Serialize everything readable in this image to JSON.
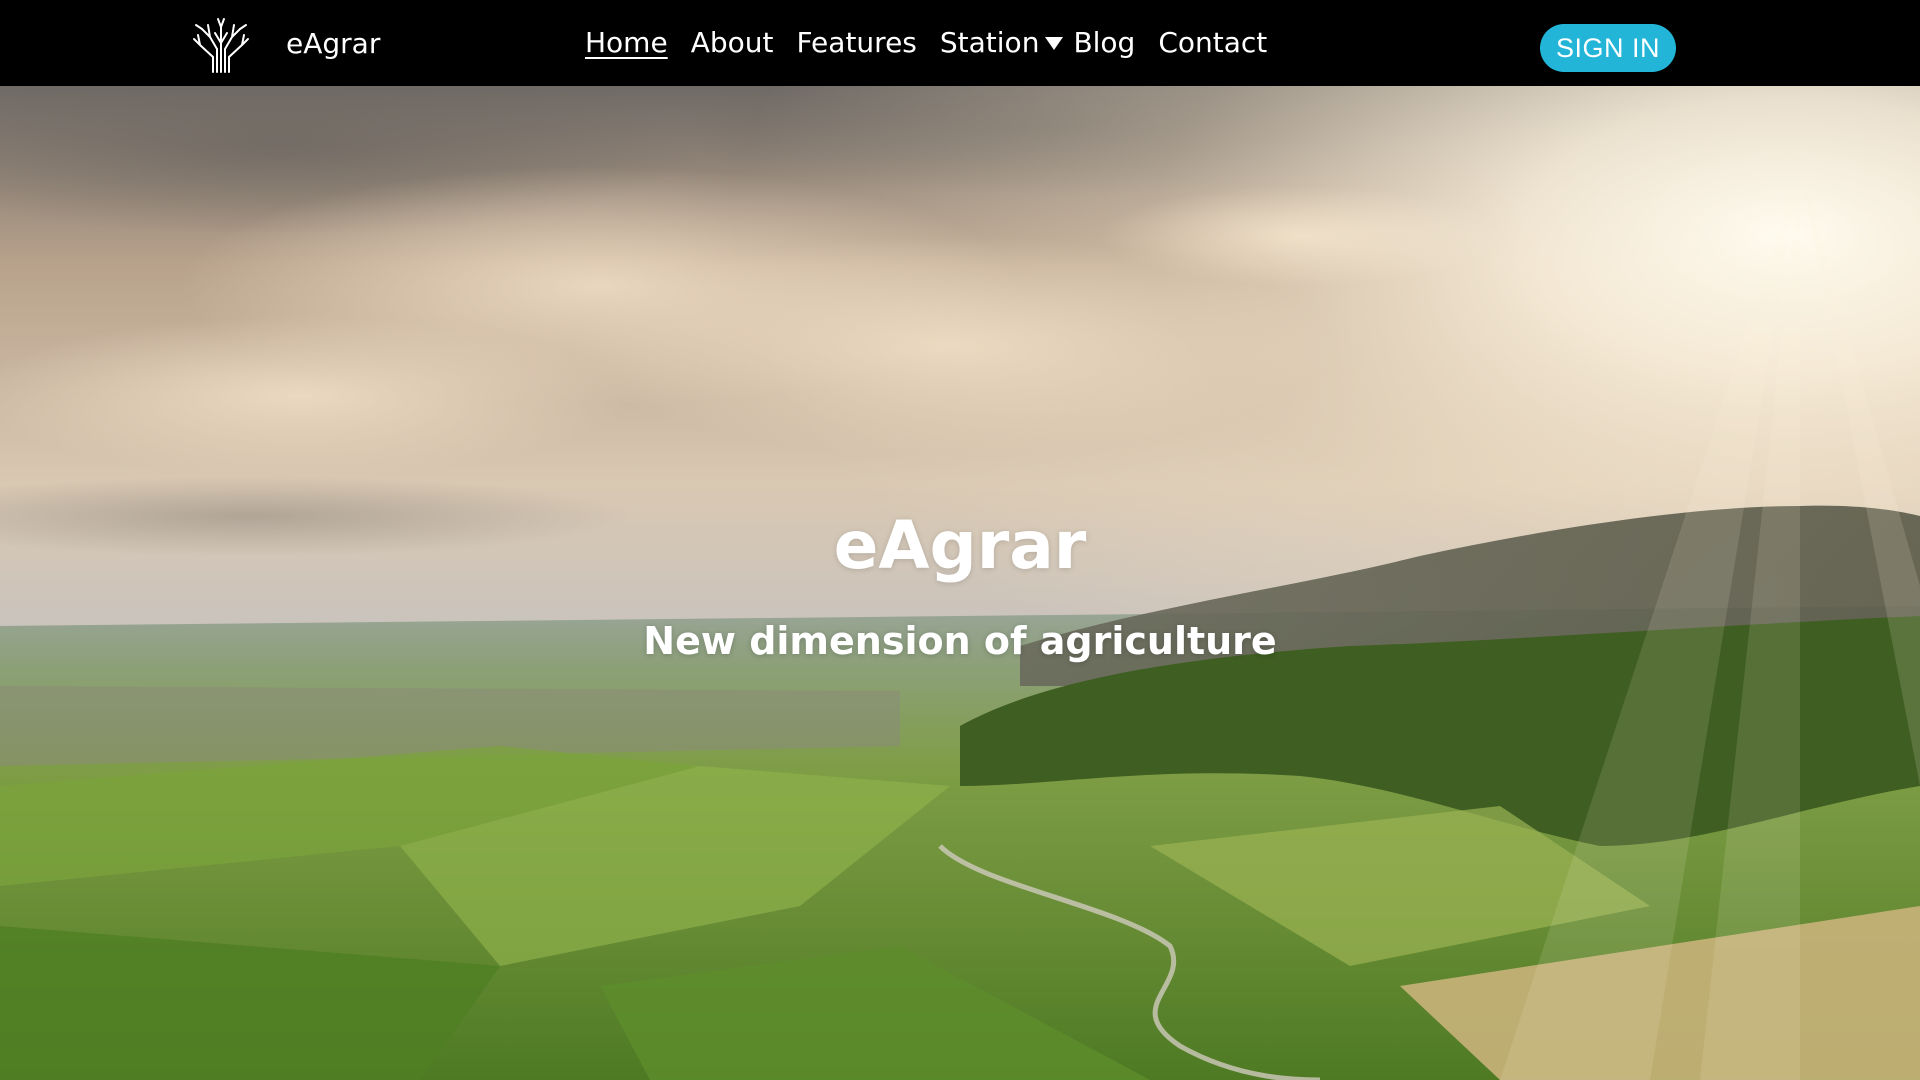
{
  "brand": {
    "name": "eAgrar",
    "logo_icon": "tree-logo-icon"
  },
  "nav": {
    "items": [
      {
        "label": "Home",
        "active": true
      },
      {
        "label": "About"
      },
      {
        "label": "Features"
      },
      {
        "label": "Station",
        "has_dropdown": true
      },
      {
        "label": "Blog"
      },
      {
        "label": "Contact"
      }
    ]
  },
  "signin": {
    "label": "SIGN IN",
    "color": "#22b5d8"
  },
  "hero": {
    "title": "eAgrar",
    "subtitle": "New dimension of agriculture",
    "background": "aerial-farmland-vineyards-sunset"
  }
}
